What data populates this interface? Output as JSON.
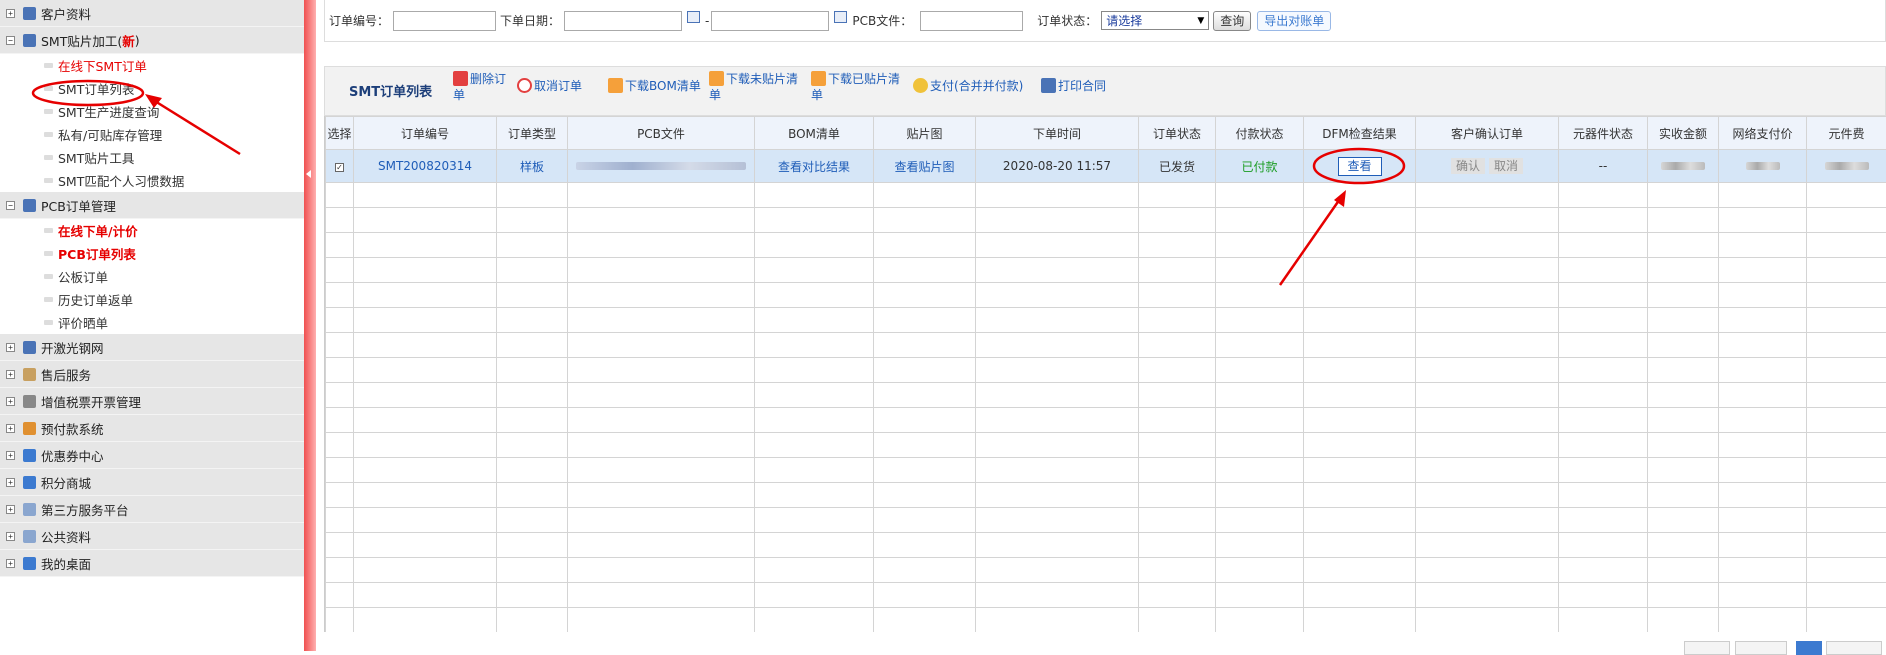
{
  "sidebar": {
    "groups": [
      {
        "label": "客户资料",
        "icon": "person-icon"
      },
      {
        "label": "SMT贴片加工(",
        "badge": "新",
        "suffix": ")",
        "icon": "chip-icon",
        "items": [
          {
            "label": "在线下SMT订单",
            "style": "red"
          },
          {
            "label": "SMT订单列表",
            "style": "normal"
          },
          {
            "label": "SMT生产进度查询",
            "style": "normal"
          },
          {
            "label": "私有/可贴库存管理",
            "style": "normal"
          },
          {
            "label": "SMT贴片工具",
            "style": "normal"
          },
          {
            "label": "SMT匹配个人习惯数据",
            "style": "normal"
          }
        ]
      },
      {
        "label": "PCB订单管理",
        "icon": "board-icon",
        "items": [
          {
            "label": "在线下单/计价",
            "style": "red-bold"
          },
          {
            "label": "PCB订单列表",
            "style": "red-bold"
          },
          {
            "label": "公板订单",
            "style": "normal"
          },
          {
            "label": "历史订单返单",
            "style": "normal"
          },
          {
            "label": "评价晒单",
            "style": "normal"
          }
        ]
      },
      {
        "label": "开激光钢网",
        "icon": "stencil-icon"
      },
      {
        "label": "售后服务",
        "icon": "service-icon"
      },
      {
        "label": "增值税票开票管理",
        "icon": "invoice-icon"
      },
      {
        "label": "预付款系统",
        "icon": "wallet-icon"
      },
      {
        "label": "优惠券中心",
        "icon": "shield-icon"
      },
      {
        "label": "积分商城",
        "icon": "points-icon"
      },
      {
        "label": "第三方服务平台",
        "icon": "platform-icon"
      },
      {
        "label": "公共资料",
        "icon": "folder-icon"
      },
      {
        "label": "我的桌面",
        "icon": "desktop-icon"
      }
    ]
  },
  "search": {
    "order_no_label": "订单编号：",
    "date_label": "下单日期：",
    "date_sep": "-",
    "pcb_file_label": "PCB文件：",
    "status_label": "订单状态：",
    "status_value": "请选择",
    "query_button": "查询",
    "export_button": "导出对账单"
  },
  "toolbar": {
    "title": "SMT订单列表",
    "delete": "删除订单",
    "cancel": "取消订单",
    "download_bom": "下载BOM清单",
    "download_unplaced": "下载未贴片清单",
    "download_placed": "下载已贴片清单",
    "pay": "支付(合并并付款)",
    "print_contract": "打印合同"
  },
  "table": {
    "headers": [
      "选择",
      "订单编号",
      "订单类型",
      "PCB文件",
      "BOM清单",
      "贴片图",
      "下单时间",
      "订单状态",
      "付款状态",
      "DFM检查结果",
      "客户确认订单",
      "元器件状态",
      "实收金额",
      "网络支付价",
      "元件费"
    ],
    "row": {
      "order_no": "SMT200820314",
      "order_type": "样板",
      "bom": "查看对比结果",
      "placement": "查看贴片图",
      "order_time": "2020-08-20 11:57",
      "order_status": "已发货",
      "pay_status": "已付款",
      "dfm": "查看",
      "confirm": "确认",
      "cancel": "取消",
      "components": "--"
    },
    "empty_rows": 18
  },
  "colors": {
    "accent_red": "#e60000",
    "link_blue": "#1f5db8",
    "paid_green": "#1a9c22",
    "selected_row": "#d6e6f7"
  }
}
